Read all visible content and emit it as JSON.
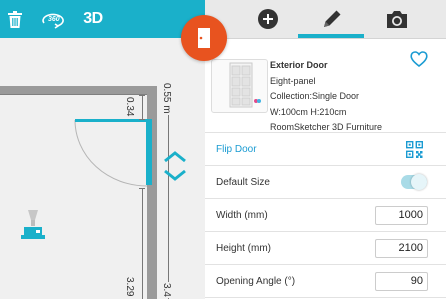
{
  "toolbar": {
    "view_3d_label": "3D",
    "colors": {
      "accent": "#1ab0ca",
      "door_badge": "#e8531f"
    }
  },
  "canvas": {
    "dimensions": {
      "top_right_label": "0.55 m",
      "left_upper_label": "0.34",
      "left_lower_label": "3.29",
      "right_lower_label": "3.4"
    }
  },
  "panel": {
    "product": {
      "title": "Exterior Door",
      "lines": [
        "Eight-panel",
        "Collection:Single Door",
        "W:100cm H:210cm",
        "RoomSketcher 3D Furniture"
      ]
    },
    "flip_door_label": "Flip Door",
    "default_size_label": "Default Size",
    "default_size_on": true,
    "fields": [
      {
        "label": "Width (mm)",
        "value": "1000"
      },
      {
        "label": "Height (mm)",
        "value": "2100"
      },
      {
        "label": "Opening Angle (°)",
        "value": "90"
      }
    ]
  }
}
